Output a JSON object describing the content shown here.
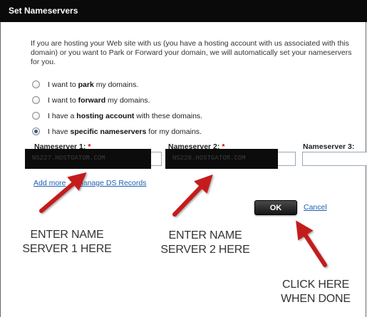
{
  "dialog": {
    "title": "Set Nameservers"
  },
  "intro": {
    "line1": "If you are hosting your Web site with us (you have a hosting account with us associated with this",
    "line2": "domain) or you want to Park or Forward your domain, we will automatically set your nameservers",
    "line3": "for you."
  },
  "options": [
    {
      "pre": "I want to ",
      "bold": "park",
      "post": " my domains.",
      "checked": false
    },
    {
      "pre": "I want to ",
      "bold": "forward",
      "post": " my domains.",
      "checked": false
    },
    {
      "pre": "I have a ",
      "bold": "hosting account",
      "post": " with these domains.",
      "checked": false
    },
    {
      "pre": "I have ",
      "bold": "specific nameservers",
      "post": " for my domains.",
      "checked": true
    }
  ],
  "nameservers": {
    "ns1_label": "Nameserver 1:",
    "ns2_label": "Nameserver 2:",
    "ns3_label": "Nameserver 3:",
    "required_mark": "*",
    "ns1_value": "NS227.HOSTGATOR.COM",
    "ns2_value": "NS228.HOSTGATOR.COM"
  },
  "links": {
    "add_more": "Add more",
    "manage_ds": "Manage DS Records"
  },
  "actions": {
    "ok_label": "OK",
    "cancel_label": "Cancel"
  },
  "annotations": {
    "ns1_line1": "ENTER NAME",
    "ns1_line2": "SERVER 1 HERE",
    "ns2_line1": "ENTER NAME",
    "ns2_line2": "SERVER 2 HERE",
    "done_line1": "CLICK HERE",
    "done_line2": "WHEN DONE"
  },
  "colors": {
    "arrow": "#c41a1a",
    "link": "#1d5fb4",
    "required": "#cc0000",
    "title_bg": "#0a0a0a"
  }
}
